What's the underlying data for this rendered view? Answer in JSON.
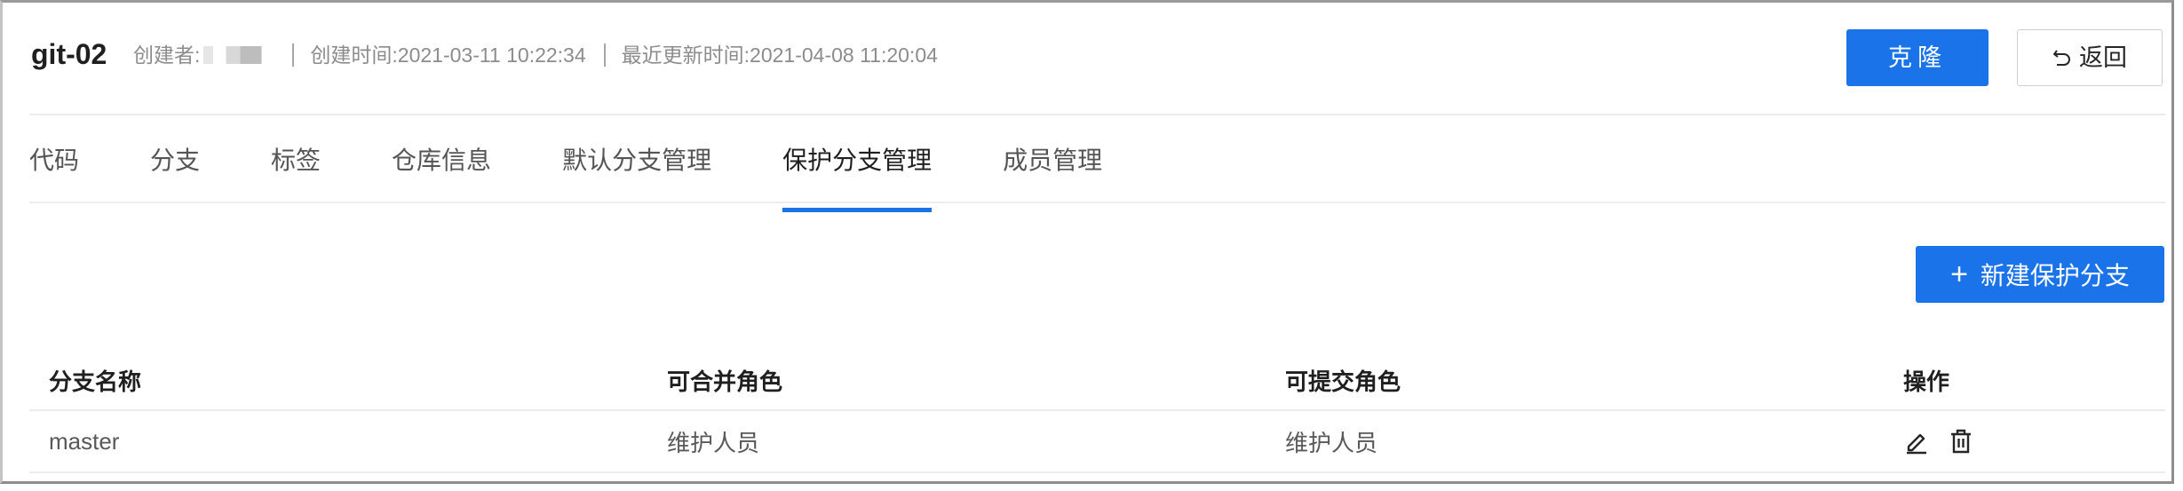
{
  "header": {
    "repo_name": "git-02",
    "creator_label": "创建者:",
    "created_time": "创建时间:2021-03-11 10:22:34",
    "updated_time": "最近更新时间:2021-04-08 11:20:04",
    "clone_label": "克隆",
    "back_label": "返回"
  },
  "tabs": [
    {
      "label": "代码",
      "active": false
    },
    {
      "label": "分支",
      "active": false
    },
    {
      "label": "标签",
      "active": false
    },
    {
      "label": "仓库信息",
      "active": false
    },
    {
      "label": "默认分支管理",
      "active": false
    },
    {
      "label": "保护分支管理",
      "active": true
    },
    {
      "label": "成员管理",
      "active": false
    }
  ],
  "toolbar": {
    "new_protected_branch_label": "新建保护分支",
    "plus_glyph": "+"
  },
  "table": {
    "columns": [
      "分支名称",
      "可合并角色",
      "可提交角色",
      "操作"
    ],
    "rows": [
      {
        "branch": "master",
        "merge_role": "维护人员",
        "push_role": "维护人员"
      }
    ]
  },
  "icons": {
    "back": "undo-arrow-icon",
    "edit": "pencil-icon",
    "delete": "trash-icon"
  },
  "colors": {
    "primary": "#1a73e8",
    "text": "#262626",
    "muted": "#8c8c8c",
    "divider": "#ececec"
  }
}
